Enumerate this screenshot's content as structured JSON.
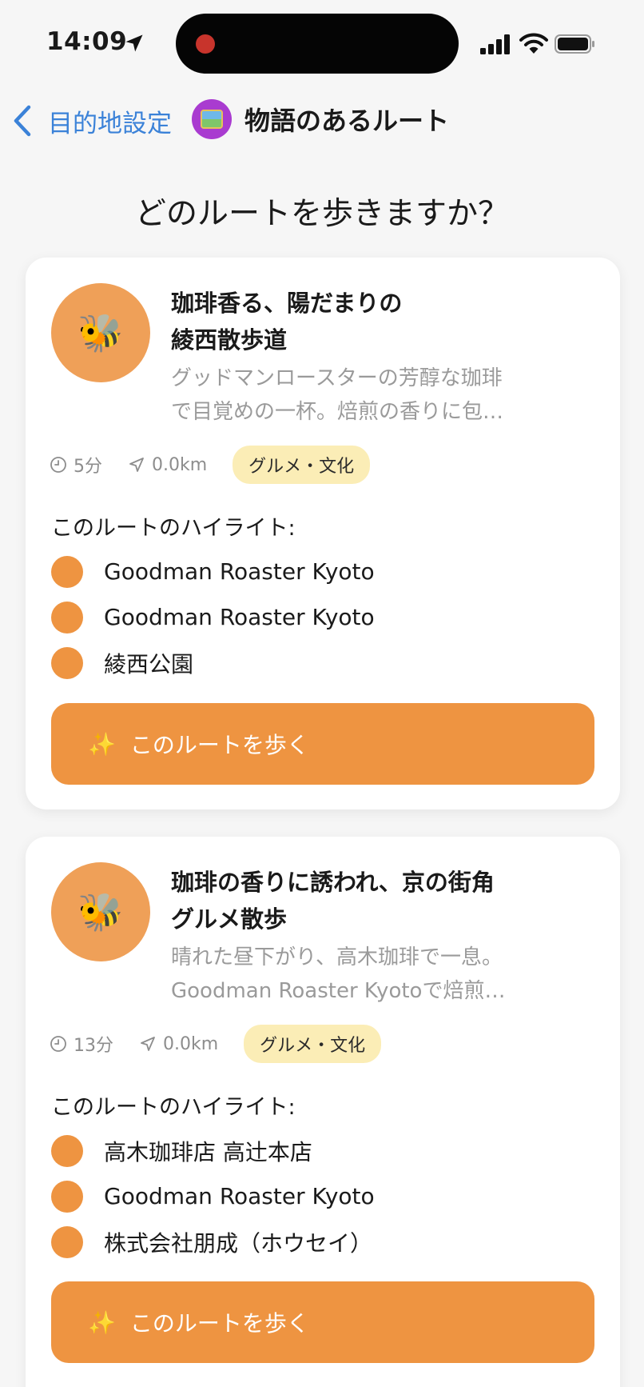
{
  "status_bar": {
    "time": "14:09"
  },
  "nav": {
    "back_label": "目的地設定",
    "title": "物語のあるルート"
  },
  "heading": "どのルートを歩きますか？",
  "routes": [
    {
      "avatar_emoji": "🐝",
      "title_line1": "珈琲香る、陽だまりの",
      "title_line2": "綾西散歩道",
      "desc_line1": "グッドマンロースターの芳醇な珈琲",
      "desc_line2": "で目覚めの一杯。焙煎の香りに包…",
      "duration": "5分",
      "distance": "0.0km",
      "category": "グルメ・文化",
      "highlights_title": "このルートのハイライト:",
      "highlights": [
        "Goodman Roaster Kyoto",
        "Goodman Roaster Kyoto",
        "綾西公園"
      ],
      "button_icon": "✨",
      "button_label": "このルートを歩く"
    },
    {
      "avatar_emoji": "🐝",
      "title_line1": "珈琲の香りに誘われ、京の街角",
      "title_line2": "グルメ散歩",
      "desc_line1": "晴れた昼下がり、高木珈琲で一息。",
      "desc_line2": "Goodman Roaster Kyotoで焙煎…",
      "duration": "13分",
      "distance": "0.0km",
      "category": "グルメ・文化",
      "highlights_title": "このルートのハイライト:",
      "highlights": [
        "高木珈琲店 高辻本店",
        "Goodman Roaster Kyoto",
        "株式会社朋成（ホウセイ）"
      ],
      "button_icon": "✨",
      "button_label": "このルートを歩く"
    }
  ],
  "colors": {
    "accent": "#ee9441",
    "link": "#3b82d8",
    "badge": "#fbedb6",
    "avatar": "#efa058"
  }
}
